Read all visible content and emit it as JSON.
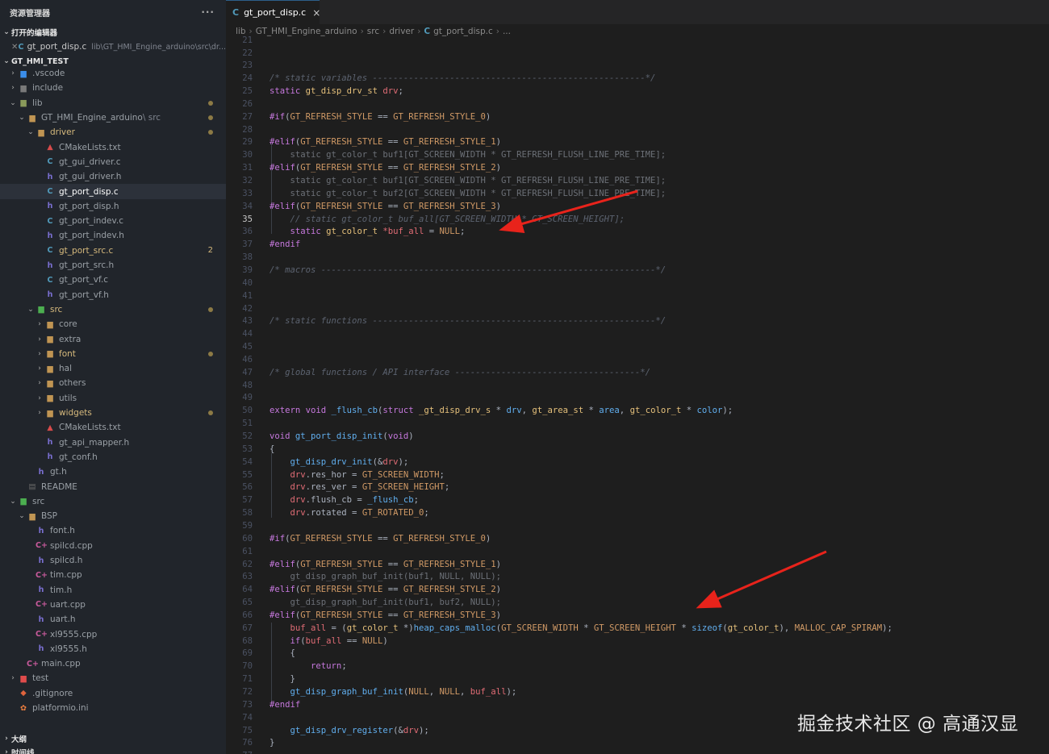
{
  "sidebar": {
    "title": "资源管理器",
    "more": "···",
    "open_editors": {
      "title": "打开的编辑器",
      "file": "gt_port_disp.c",
      "path": "lib\\GT_HMI_Engine_arduino\\src\\dr..."
    },
    "workspace": "GT_HMI_TEST",
    "tree": [
      {
        "label": ".vscode",
        "icon": "folder-vscode-icon",
        "depth": 0,
        "chev": "closed"
      },
      {
        "label": "include",
        "icon": "folder-include-icon",
        "depth": 0,
        "chev": "closed"
      },
      {
        "label": "lib",
        "icon": "folder-lib-icon",
        "depth": 0,
        "chev": "open",
        "dot": true
      },
      {
        "label": "GT_HMI_Engine_arduino",
        "sub": "src",
        "icon": "folder-icon",
        "depth": 1,
        "chev": "open",
        "dot": true
      },
      {
        "label": "driver",
        "icon": "folder-icon",
        "depth": 2,
        "chev": "open",
        "dot": true,
        "mod": true
      },
      {
        "label": "CMakeLists.txt",
        "icon": "cmake-icon",
        "depth": 3
      },
      {
        "label": "gt_gui_driver.c",
        "icon": "c-file-icon",
        "depth": 3
      },
      {
        "label": "gt_gui_driver.h",
        "icon": "h-file-icon",
        "depth": 3
      },
      {
        "label": "gt_port_disp.c",
        "icon": "c-file-icon",
        "depth": 3,
        "selected": true
      },
      {
        "label": "gt_port_disp.h",
        "icon": "h-file-icon",
        "depth": 3
      },
      {
        "label": "gt_port_indev.c",
        "icon": "c-file-icon",
        "depth": 3
      },
      {
        "label": "gt_port_indev.h",
        "icon": "h-file-icon",
        "depth": 3
      },
      {
        "label": "gt_port_src.c",
        "icon": "c-file-icon",
        "depth": 3,
        "badge": "2",
        "mod": true
      },
      {
        "label": "gt_port_src.h",
        "icon": "h-file-icon",
        "depth": 3
      },
      {
        "label": "gt_port_vf.c",
        "icon": "c-file-icon",
        "depth": 3
      },
      {
        "label": "gt_port_vf.h",
        "icon": "h-file-icon",
        "depth": 3
      },
      {
        "label": "src",
        "icon": "folder-src-icon",
        "depth": 2,
        "chev": "open",
        "dot": true,
        "mod": true
      },
      {
        "label": "core",
        "icon": "folder-icon",
        "depth": 3,
        "chev": "closed"
      },
      {
        "label": "extra",
        "icon": "folder-icon",
        "depth": 3,
        "chev": "closed"
      },
      {
        "label": "font",
        "icon": "folder-icon",
        "depth": 3,
        "chev": "closed",
        "dot": true,
        "mod": true
      },
      {
        "label": "hal",
        "icon": "folder-icon",
        "depth": 3,
        "chev": "closed"
      },
      {
        "label": "others",
        "icon": "folder-icon",
        "depth": 3,
        "chev": "closed"
      },
      {
        "label": "utils",
        "icon": "folder-icon",
        "depth": 3,
        "chev": "closed"
      },
      {
        "label": "widgets",
        "icon": "folder-icon",
        "depth": 3,
        "chev": "closed",
        "dot": true,
        "mod": true
      },
      {
        "label": "CMakeLists.txt",
        "icon": "cmake-icon",
        "depth": 3
      },
      {
        "label": "gt_api_mapper.h",
        "icon": "h-file-icon",
        "depth": 3
      },
      {
        "label": "gt_conf.h",
        "icon": "h-file-icon",
        "depth": 3
      },
      {
        "label": "gt.h",
        "icon": "h-file-icon",
        "depth": 2
      },
      {
        "label": "README",
        "icon": "readme-icon",
        "depth": 1
      },
      {
        "label": "src",
        "icon": "folder-src-icon",
        "depth": 0,
        "chev": "open"
      },
      {
        "label": "BSP",
        "icon": "folder-icon",
        "depth": 1,
        "chev": "open"
      },
      {
        "label": "font.h",
        "icon": "h-file-icon",
        "depth": 2
      },
      {
        "label": "spilcd.cpp",
        "icon": "cpp-file-icon",
        "depth": 2
      },
      {
        "label": "spilcd.h",
        "icon": "h-file-icon",
        "depth": 2
      },
      {
        "label": "tim.cpp",
        "icon": "cpp-file-icon",
        "depth": 2
      },
      {
        "label": "tim.h",
        "icon": "h-file-icon",
        "depth": 2
      },
      {
        "label": "uart.cpp",
        "icon": "cpp-file-icon",
        "depth": 2
      },
      {
        "label": "uart.h",
        "icon": "h-file-icon",
        "depth": 2
      },
      {
        "label": "xl9555.cpp",
        "icon": "cpp-file-icon",
        "depth": 2
      },
      {
        "label": "xl9555.h",
        "icon": "h-file-icon",
        "depth": 2
      },
      {
        "label": "main.cpp",
        "icon": "cpp-file-icon",
        "depth": 1
      },
      {
        "label": "test",
        "icon": "folder-test-icon",
        "depth": 0,
        "chev": "closed"
      },
      {
        "label": ".gitignore",
        "icon": "git-icon",
        "depth": 0
      },
      {
        "label": "platformio.ini",
        "icon": "platformio-icon",
        "depth": 0
      }
    ],
    "outline": "大纲",
    "timeline": "时间线"
  },
  "tab": {
    "label": "gt_port_disp.c",
    "close": "×"
  },
  "breadcrumb": [
    "lib",
    "GT_HMI_Engine_arduino",
    "src",
    "driver",
    "gt_port_disp.c",
    "..."
  ],
  "editor": {
    "first_line": 21,
    "current_line": 35,
    "lines": [
      [],
      [],
      [],
      [
        [
          "cm",
          "/* static variables -----------------------------------------------------*/"
        ]
      ],
      [
        [
          "kw",
          "static "
        ],
        [
          "ty",
          "gt_disp_drv_st "
        ],
        [
          "va",
          "drv"
        ],
        [
          "",
          "; "
        ]
      ],
      [],
      [
        [
          "pp",
          "#if"
        ],
        [
          "",
          "("
        ],
        [
          "mac",
          "GT_REFRESH_STYLE"
        ],
        [
          "",
          " == "
        ],
        [
          "mac",
          "GT_REFRESH_STYLE_0"
        ],
        [
          "",
          ")"
        ]
      ],
      [],
      [
        [
          "pp",
          "#elif"
        ],
        [
          "",
          "("
        ],
        [
          "mac",
          "GT_REFRESH_STYLE"
        ],
        [
          "",
          " == "
        ],
        [
          "mac",
          "GT_REFRESH_STYLE_1"
        ],
        [
          "",
          ")"
        ]
      ],
      [
        [
          "dim",
          "    static gt_color_t buf1[GT_SCREEN_WIDTH * GT_REFRESH_FLUSH_LINE_PRE_TIME];"
        ]
      ],
      [
        [
          "pp",
          "#elif"
        ],
        [
          "",
          "("
        ],
        [
          "mac",
          "GT_REFRESH_STYLE"
        ],
        [
          "",
          " == "
        ],
        [
          "mac",
          "GT_REFRESH_STYLE_2"
        ],
        [
          "",
          ")"
        ]
      ],
      [
        [
          "dim",
          "    static gt_color_t buf1[GT_SCREEN_WIDTH * GT_REFRESH_FLUSH_LINE_PRE_TIME];"
        ]
      ],
      [
        [
          "dim",
          "    static gt_color_t buf2[GT_SCREEN_WIDTH * GT_REFRESH_FLUSH_LINE_PRE_TIME];"
        ]
      ],
      [
        [
          "pp",
          "#elif"
        ],
        [
          "",
          "("
        ],
        [
          "mac",
          "GT_REFRESH_STYLE"
        ],
        [
          "",
          " == "
        ],
        [
          "mac",
          "GT_REFRESH_STYLE_3"
        ],
        [
          "",
          ")"
        ]
      ],
      [
        [
          "cm",
          "    // static gt_color_t buf_all[GT_SCREEN_WIDTH * GT_SCREEN_HEIGHT];"
        ]
      ],
      [
        [
          "",
          "    "
        ],
        [
          "kw",
          "static "
        ],
        [
          "ty",
          "gt_color_t "
        ],
        [
          "",
          ""
        ],
        [
          "va",
          "*buf_all"
        ],
        [
          "",
          " = "
        ],
        [
          "mac",
          "NULL"
        ],
        [
          "",
          ";"
        ]
      ],
      [
        [
          "pp",
          "#endif"
        ]
      ],
      [],
      [
        [
          "cm",
          "/* macros -----------------------------------------------------------------*/"
        ]
      ],
      [],
      [],
      [],
      [
        [
          "cm",
          "/* static functions -------------------------------------------------------*/"
        ]
      ],
      [],
      [],
      [],
      [
        [
          "cm",
          "/* global functions / API interface ------------------------------------*/"
        ]
      ],
      [],
      [],
      [
        [
          "kw",
          "extern "
        ],
        [
          "kw",
          "void "
        ],
        [
          "fn",
          "_flush_cb"
        ],
        [
          "",
          "("
        ],
        [
          "kw",
          "struct "
        ],
        [
          "ty",
          "_gt_disp_drv_s "
        ],
        [
          "",
          "* "
        ],
        [
          "pa",
          "drv"
        ],
        [
          ", "
        ],
        [
          "ty",
          "gt_area_st "
        ],
        [
          "",
          "* "
        ],
        [
          "pa",
          "area"
        ],
        [
          ", "
        ],
        [
          "ty",
          "gt_color_t "
        ],
        [
          "",
          "* "
        ],
        [
          "pa",
          "color"
        ],
        [
          ");"
        ]
      ],
      [],
      [
        [
          "kw",
          "void "
        ],
        [
          "fn",
          "gt_port_disp_init"
        ],
        [
          "",
          "("
        ],
        [
          "kw",
          "void"
        ],
        [
          "",
          ")"
        ]
      ],
      [
        [
          "",
          "{"
        ]
      ],
      [
        [
          "",
          "    "
        ],
        [
          "fn",
          "gt_disp_drv_init"
        ],
        [
          "",
          "(&"
        ],
        [
          "va",
          "drv"
        ],
        [
          "",
          ");"
        ]
      ],
      [
        [
          "",
          "    "
        ],
        [
          "va",
          "drv"
        ],
        [
          "",
          ".res_hor = "
        ],
        [
          "mac",
          "GT_SCREEN_WIDTH"
        ],
        [
          "",
          ";"
        ]
      ],
      [
        [
          "",
          "    "
        ],
        [
          "va",
          "drv"
        ],
        [
          "",
          ".res_ver = "
        ],
        [
          "mac",
          "GT_SCREEN_HEIGHT"
        ],
        [
          "",
          ";"
        ]
      ],
      [
        [
          "",
          "    "
        ],
        [
          "va",
          "drv"
        ],
        [
          "",
          ".flush_cb = "
        ],
        [
          "fn",
          "_flush_cb"
        ],
        [
          "",
          ";"
        ]
      ],
      [
        [
          "",
          "    "
        ],
        [
          "va",
          "drv"
        ],
        [
          "",
          ".rotated = "
        ],
        [
          "mac",
          "GT_ROTATED_0"
        ],
        [
          "",
          ";"
        ]
      ],
      [],
      [
        [
          "pp",
          "#if"
        ],
        [
          "",
          "("
        ],
        [
          "mac",
          "GT_REFRESH_STYLE"
        ],
        [
          "",
          " == "
        ],
        [
          "mac",
          "GT_REFRESH_STYLE_0"
        ],
        [
          "",
          ")"
        ]
      ],
      [],
      [
        [
          "pp",
          "#elif"
        ],
        [
          "",
          "("
        ],
        [
          "mac",
          "GT_REFRESH_STYLE"
        ],
        [
          "",
          " == "
        ],
        [
          "mac",
          "GT_REFRESH_STYLE_1"
        ],
        [
          "",
          ")"
        ]
      ],
      [
        [
          "dim",
          "    gt_disp_graph_buf_init(buf1, NULL, NULL);"
        ]
      ],
      [
        [
          "pp",
          "#elif"
        ],
        [
          "",
          "("
        ],
        [
          "mac",
          "GT_REFRESH_STYLE"
        ],
        [
          "",
          " == "
        ],
        [
          "mac",
          "GT_REFRESH_STYLE_2"
        ],
        [
          "",
          ")"
        ]
      ],
      [
        [
          "dim",
          "    gt_disp_graph_buf_init(buf1, buf2, NULL);"
        ]
      ],
      [
        [
          "pp",
          "#elif"
        ],
        [
          "",
          "("
        ],
        [
          "mac",
          "GT_REFRESH_STYLE"
        ],
        [
          "",
          " == "
        ],
        [
          "mac",
          "GT_REFRESH_STYLE_3"
        ],
        [
          "",
          ")"
        ]
      ],
      [
        [
          "",
          "    "
        ],
        [
          "va",
          "buf_all"
        ],
        [
          "",
          " = ("
        ],
        [
          "ty",
          "gt_color_t "
        ],
        [
          "",
          "*)"
        ],
        [
          "fn",
          "heap_caps_malloc"
        ],
        [
          "",
          "("
        ],
        [
          "mac",
          "GT_SCREEN_WIDTH"
        ],
        [
          "",
          " * "
        ],
        [
          "mac",
          "GT_SCREEN_HEIGHT"
        ],
        [
          "",
          " * "
        ],
        [
          "fn",
          "sizeof"
        ],
        [
          "",
          "("
        ],
        [
          "ty",
          "gt_color_t"
        ],
        [
          "",
          "), "
        ],
        [
          "mac",
          "MALLOC_CAP_SPIRAM"
        ],
        [
          "",
          ");"
        ]
      ],
      [
        [
          "",
          "    "
        ],
        [
          "kw",
          "if"
        ],
        [
          "",
          "("
        ],
        [
          "va",
          "buf_all"
        ],
        [
          "",
          " == "
        ],
        [
          "mac",
          "NULL"
        ],
        [
          "",
          ")"
        ]
      ],
      [
        [
          "",
          "    {"
        ]
      ],
      [
        [
          "",
          "        "
        ],
        [
          "kw",
          "return"
        ],
        [
          "",
          ";"
        ]
      ],
      [
        [
          "",
          "    }"
        ]
      ],
      [
        [
          "",
          "    "
        ],
        [
          "fn",
          "gt_disp_graph_buf_init"
        ],
        [
          "",
          "("
        ],
        [
          "mac",
          "NULL"
        ],
        [
          ", "
        ],
        [
          "mac",
          "NULL"
        ],
        [
          ", "
        ],
        [
          "va",
          "buf_all"
        ],
        [
          "",
          ");"
        ]
      ],
      [
        [
          "pp",
          "#endif"
        ]
      ],
      [],
      [
        [
          "",
          "    "
        ],
        [
          "fn",
          "gt_disp_drv_register"
        ],
        [
          "",
          "(&"
        ],
        [
          "va",
          "drv"
        ],
        [
          "",
          ");"
        ]
      ],
      [
        [
          "",
          "}"
        ]
      ],
      []
    ]
  },
  "watermark": "掘金技术社区 @ 高通汉显",
  "colors": {
    "accent": "#519aba",
    "arrow": "#e8231b",
    "modified": "#d7ba7d"
  }
}
